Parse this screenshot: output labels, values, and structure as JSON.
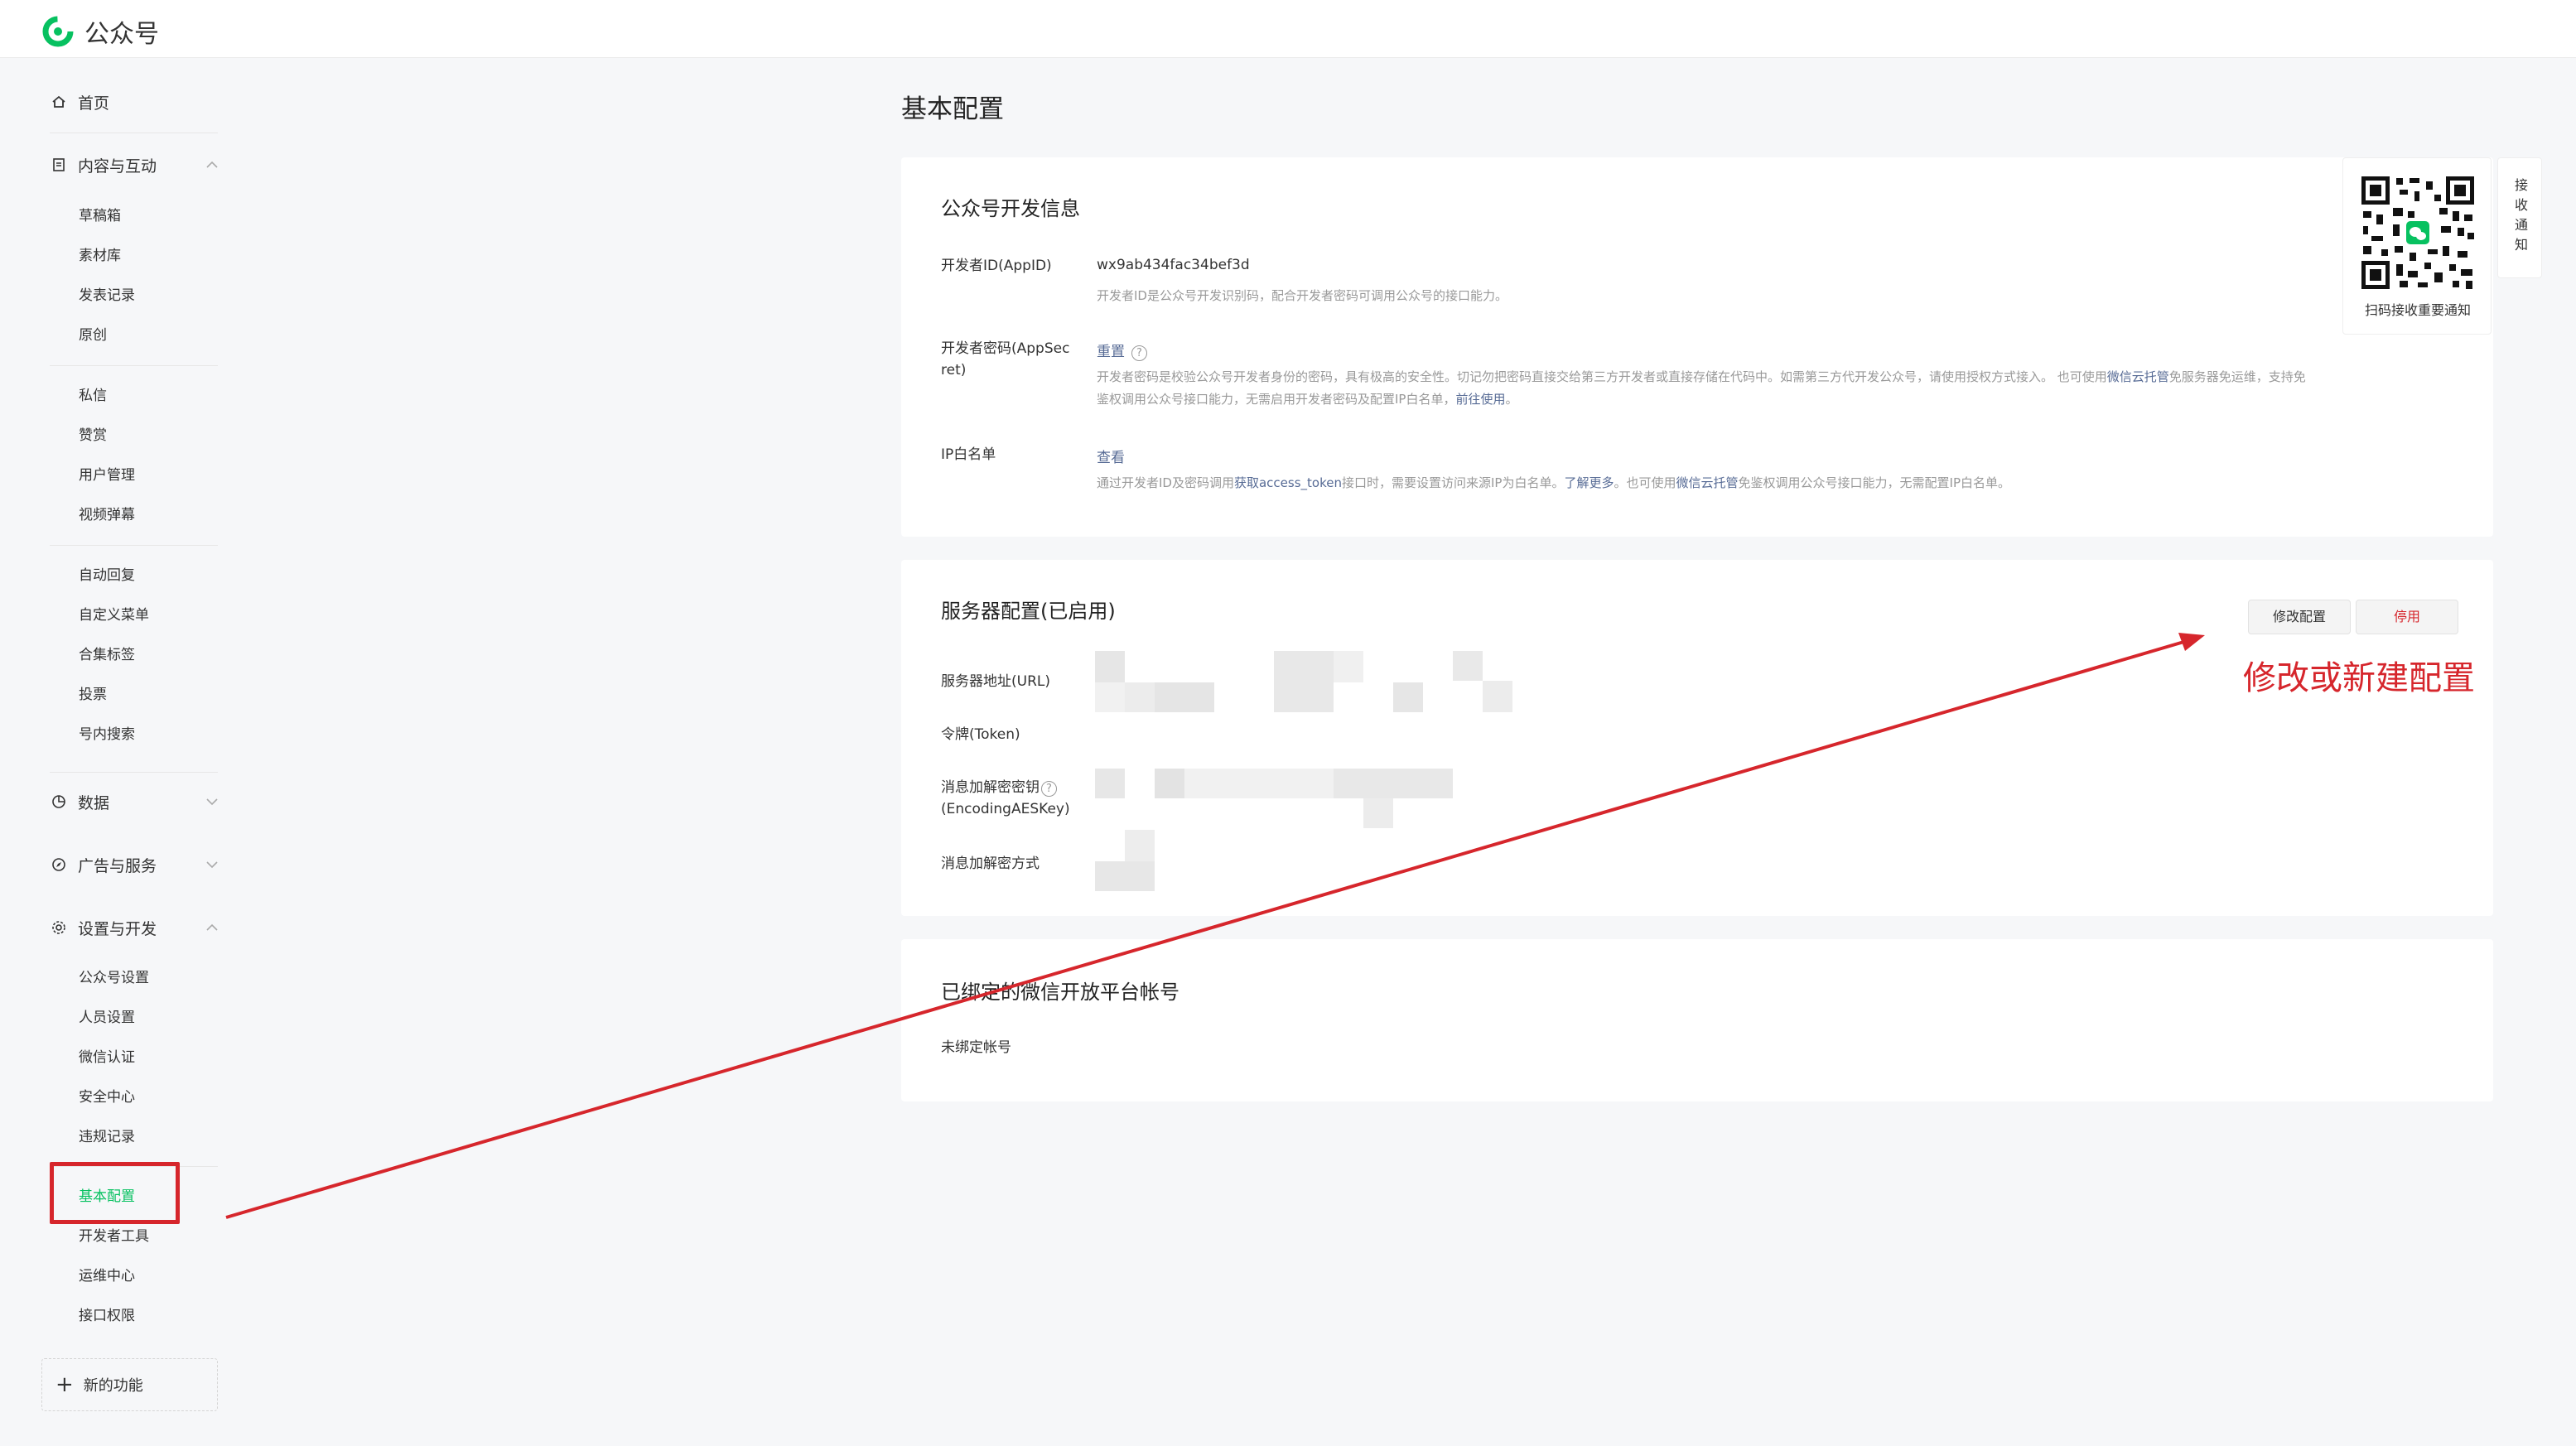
{
  "app": {
    "title": "公众号"
  },
  "sidebar": {
    "home": "首页",
    "content": {
      "label": "内容与互动",
      "items": [
        "草稿箱",
        "素材库",
        "发表记录",
        "原创"
      ]
    },
    "interact_items": [
      "私信",
      "赞赏",
      "用户管理",
      "视频弹幕"
    ],
    "tools_items": [
      "自动回复",
      "自定义菜单",
      "合集标签",
      "投票",
      "号内搜索"
    ],
    "data": "数据",
    "ads": "广告与服务",
    "settings": {
      "label": "设置与开发",
      "items": [
        "公众号设置",
        "人员设置",
        "微信认证",
        "安全中心",
        "违规记录"
      ]
    },
    "dev_items": [
      "基本配置",
      "开发者工具",
      "运维中心",
      "接口权限"
    ],
    "new_feature": "新的功能"
  },
  "main": {
    "title": "基本配置",
    "dev_info": {
      "title": "公众号开发信息",
      "appid_label": "开发者ID(AppID)",
      "appid_value": "wx9ab434fac34bef3d",
      "appid_desc": "开发者ID是公众号开发识别码，配合开发者密码可调用公众号的接口能力。",
      "secret_label_1": "开发者密码(AppSec",
      "secret_label_2": "ret)",
      "secret_action": "重置",
      "secret_desc_1a": "开发者密码是校验公众号开发者身份的密码，具有极高的安全性。切记勿把密码直接交给第三方开发者或直接存储在代码中。如需第三方代开发公众号，请使用授权方式接入。 也可使用",
      "secret_desc_1link": "微信云托管",
      "secret_desc_1b": "免服务器免运维，支持免",
      "secret_desc_2a": "鉴权调用公众号接口能力，无需启用开发者密码及配置IP白名单，",
      "secret_desc_2link": "前往使用",
      "secret_desc_2b": "。",
      "ip_label": "IP白名单",
      "ip_action": "查看",
      "ip_desc_a": "通过开发者ID及密码调用",
      "ip_desc_link1": "获取access_token",
      "ip_desc_b": "接口时，需要设置访问来源IP为白名单。",
      "ip_desc_link2": "了解更多",
      "ip_desc_c": "。也可使用",
      "ip_desc_link3": "微信云托管",
      "ip_desc_d": "免鉴权调用公众号接口能力，无需配置IP白名单。"
    },
    "server": {
      "title": "服务器配置(已启用)",
      "edit_button": "修改配置",
      "disable_button": "停用",
      "url_label": "服务器地址(URL)",
      "token_label": "令牌(Token)",
      "aes_label_1": "消息加解密密钥",
      "aes_label_2": "(EncodingAESKey)",
      "mode_label": "消息加解密方式"
    },
    "open_platform": {
      "title": "已绑定的微信开放平台帐号",
      "status": "未绑定帐号"
    },
    "qr": {
      "caption": "扫码接收重要通知"
    },
    "notify_tab": "接收通知"
  },
  "annotation": {
    "text": "修改或新建配置",
    "color": "#d6262c"
  },
  "colors": {
    "accent": "#07c160",
    "link": "#576b95",
    "danger": "#d6262c"
  }
}
